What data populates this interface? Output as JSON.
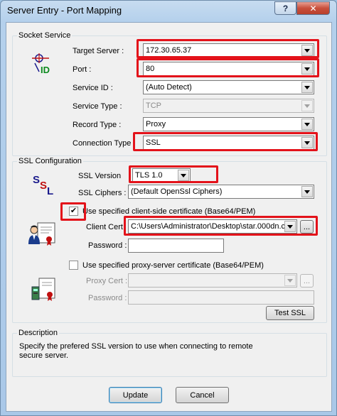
{
  "window": {
    "title": "Server Entry - Port Mapping",
    "help_label": "?",
    "close_label": "✕"
  },
  "socket_service": {
    "group_label": "Socket Service",
    "target_server": {
      "label": "Target Server :",
      "value": "172.30.65.37"
    },
    "port": {
      "label": "Port :",
      "value": "80"
    },
    "service_id": {
      "label": "Service ID :",
      "value": "(Auto Detect)"
    },
    "service_type": {
      "label": "Service Type :",
      "value": "TCP"
    },
    "record_type": {
      "label": "Record Type :",
      "value": "Proxy"
    },
    "connection_type": {
      "label": "Connection Type",
      "value": "SSL"
    },
    "icon": "target-id-icon"
  },
  "ssl_configuration": {
    "group_label": "SSL Configuration",
    "ssl_version": {
      "label": "SSL Version",
      "value": "TLS 1.0"
    },
    "ssl_ciphers": {
      "label": "SSL Ciphers :",
      "value": "(Default OpenSsl Ciphers)"
    },
    "ssl_icon": "ssl-icon",
    "client_cert_checkbox": {
      "label": "Use specified client-side certificate (Base64/PEM)",
      "checked": true
    },
    "client_cert": {
      "label": "Client Cert",
      "value": "C:\\Users\\Administrator\\Desktop\\star.000dn.c"
    },
    "browse_label": "...",
    "password": {
      "label": "Password :",
      "value": ""
    },
    "proxy_cert_checkbox": {
      "label": "Use specified proxy-server certificate (Base64/PEM)",
      "checked": false
    },
    "proxy_cert": {
      "label": "Proxy Cert :",
      "value": ""
    },
    "proxy_browse_label": "...",
    "proxy_password": {
      "label": "Password :",
      "value": ""
    },
    "test_ssl_label": "Test SSL",
    "cert_icon": "certificate-icon"
  },
  "description": {
    "group_label": "Description",
    "text_line1": "Specify the prefered SSL version to use when connecting to remote",
    "text_line2": "secure server."
  },
  "footer": {
    "update_label": "Update",
    "cancel_label": "Cancel"
  },
  "colors": {
    "highlight": "#e3121a",
    "title_bar": "#b4d0ec",
    "close_button": "#c9503c"
  }
}
